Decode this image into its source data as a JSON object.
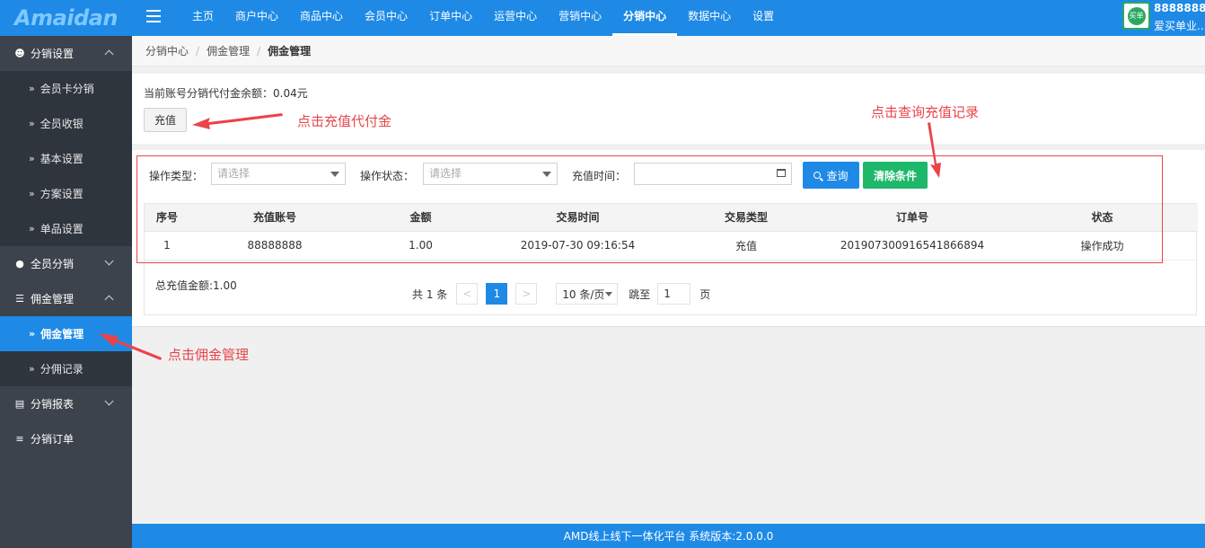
{
  "header": {
    "logo": "Amaidan",
    "nav": [
      "主页",
      "商户中心",
      "商品中心",
      "会员中心",
      "订单中心",
      "运营中心",
      "营销中心",
      "分销中心",
      "数据中心",
      "设置"
    ],
    "active_nav": "分销中心",
    "user_id": "88888888",
    "user_name": "爱买单业...",
    "avatar_text": "买单"
  },
  "sidebar": {
    "groups": [
      {
        "label": "分销设置",
        "icon": "users-icon",
        "expanded": true,
        "items": [
          "会员卡分销",
          "全员收银",
          "基本设置",
          "方案设置",
          "单品设置"
        ]
      },
      {
        "label": "全员分销",
        "icon": "user-icon",
        "expanded": false,
        "items": []
      },
      {
        "label": "佣金管理",
        "icon": "database-icon",
        "expanded": true,
        "items": [
          "佣金管理",
          "分佣记录"
        ]
      },
      {
        "label": "分销报表",
        "icon": "report-icon",
        "expanded": false,
        "items": []
      },
      {
        "label": "分销订单",
        "icon": "list-icon",
        "expanded": false,
        "items": []
      }
    ],
    "active_item": "佣金管理",
    "item_prefix": "»"
  },
  "breadcrumb": [
    "分销中心",
    "佣金管理",
    "佣金管理"
  ],
  "breadcrumb_sep": "/",
  "balance": {
    "text": "当前账号分销代付金余额：0.04元",
    "recharge_label": "充值"
  },
  "filters": {
    "type_label": "操作类型：",
    "type_placeholder": "请选择",
    "status_label": "操作状态：",
    "status_placeholder": "请选择",
    "time_label": "充值时间：",
    "query_label": "查询",
    "clear_label": "清除条件"
  },
  "table": {
    "columns": [
      "序号",
      "充值账号",
      "金额",
      "交易时间",
      "交易类型",
      "订单号",
      "状态"
    ],
    "rows": [
      [
        "1",
        "88888888",
        "1.00",
        "2019-07-30 09:16:54",
        "充值",
        "201907300916541866894",
        "操作成功"
      ]
    ]
  },
  "summary": {
    "total": "总充值金额:1.00"
  },
  "pagination": {
    "total": "共 1 条",
    "prev": "<",
    "current": "1",
    "next": ">",
    "page_size": "10 条/页",
    "jump_label": "跳至",
    "jump_value": "1",
    "page_unit": "页"
  },
  "footer": "AMD线上线下一体化平台 系统版本:2.0.0.0",
  "annotations": {
    "recharge_hint": "点击充值代付金",
    "query_hint": "点击查询充值记录",
    "commission_hint": "点击佣金管理",
    "color": "#e8454a"
  },
  "colors": {
    "primary": "#1e8ae6",
    "success": "#1fb86a",
    "sidebar": "#3c434c"
  }
}
